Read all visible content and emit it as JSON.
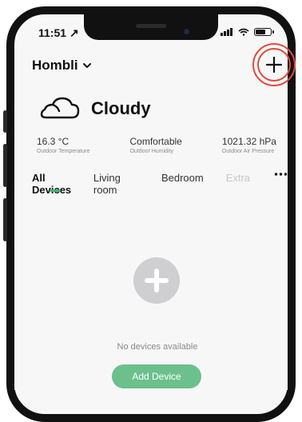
{
  "status_bar": {
    "time": "11:51",
    "location_arrow": "↗"
  },
  "header": {
    "home_name": "Hombli",
    "add_icon": "plus-icon"
  },
  "weather": {
    "condition": "Cloudy",
    "icon": "cloud-icon",
    "stats": [
      {
        "value": "16.3 °C",
        "label": "Outdoor Temperature"
      },
      {
        "value": "Comfortable",
        "label": "Outdoor Humidity"
      },
      {
        "value": "1021.32 hPa",
        "label": "Outdoor Air Pressure"
      }
    ]
  },
  "tabs": [
    {
      "label": "All Devices"
    },
    {
      "label": "Living room"
    },
    {
      "label": "Bedroom"
    },
    {
      "label": "Extra"
    }
  ],
  "empty_state": {
    "message": "No devices available",
    "button_label": "Add Device"
  },
  "colors": {
    "accent_green": "#43b671",
    "button_green": "#6cc08b",
    "highlight_red": "#e04b3a"
  }
}
